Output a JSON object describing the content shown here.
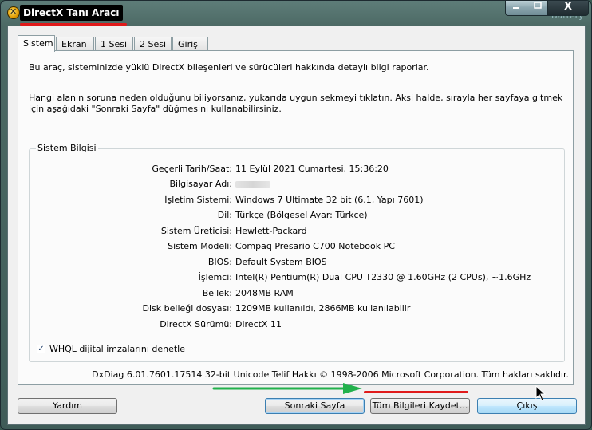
{
  "window": {
    "title": "DirectX Tanı Aracı",
    "min_icon": "minimize-icon",
    "max_icon": "maximize-icon",
    "close_icon": "close-icon",
    "close_glyph": "X",
    "background_hint": "Battery"
  },
  "tabs": [
    {
      "label": "Sistem",
      "active": true
    },
    {
      "label": "Ekran",
      "active": false
    },
    {
      "label": "1 Sesi",
      "active": false
    },
    {
      "label": "2 Sesi",
      "active": false
    },
    {
      "label": "Giriş",
      "active": false
    }
  ],
  "intro": {
    "line1": "Bu araç, sisteminizde yüklü DirectX bileşenleri ve sürücüleri hakkında detaylı bilgi raporlar.",
    "line2": "Hangi alanın soruna neden olduğunu biliyorsanız, yukarıda uygun sekmeyi tıklatın.  Aksi halde, sırayla her sayfaya gitmek için aşağıdaki \"Sonraki Sayfa\" düğmesini kullanabilirsiniz."
  },
  "system_info": {
    "group_title": "Sistem Bilgisi",
    "rows": [
      {
        "label": "Geçerli Tarih/Saat:",
        "value": "11 Eylül 2021 Cumartesi, 15:36:20"
      },
      {
        "label": "Bilgisayar Adı:",
        "value": ""
      },
      {
        "label": "İşletim Sistemi:",
        "value": "Windows 7 Ultimate 32 bit (6.1, Yapı 7601)"
      },
      {
        "label": "Dil:",
        "value": "Türkçe (Bölgesel Ayar: Türkçe)"
      },
      {
        "label": "Sistem Üreticisi:",
        "value": "Hewlett-Packard"
      },
      {
        "label": "Sistem Modeli:",
        "value": "Compaq Presario C700 Notebook PC"
      },
      {
        "label": "BIOS:",
        "value": "Default System BIOS"
      },
      {
        "label": "İşlemci:",
        "value": "Intel(R) Pentium(R) Dual  CPU  T2330  @ 1.60GHz (2 CPUs), ~1.6GHz"
      },
      {
        "label": "Bellek:",
        "value": "2048MB RAM"
      },
      {
        "label": "Disk belleği dosyası:",
        "value": "1209MB kullanıldı, 2866MB kullanılabilir"
      },
      {
        "label": "DirectX Sürümü:",
        "value": "DirectX 11"
      }
    ]
  },
  "whql": {
    "label": "WHQL dijital imzalarını denetle",
    "checked": true
  },
  "footer": "DxDiag 6.01.7601.17514 32-bit Unicode  Telif Hakkı © 1998-2006 Microsoft Corporation.  Tüm hakları saklıdır.",
  "buttons": {
    "help": "Yardım",
    "next": "Sonraki Sayfa",
    "save_all": "Tüm Bilgileri Kaydet...",
    "exit": "Çıkış"
  },
  "annotations": {
    "red": "#e01a1a",
    "green": "#22b14c"
  }
}
